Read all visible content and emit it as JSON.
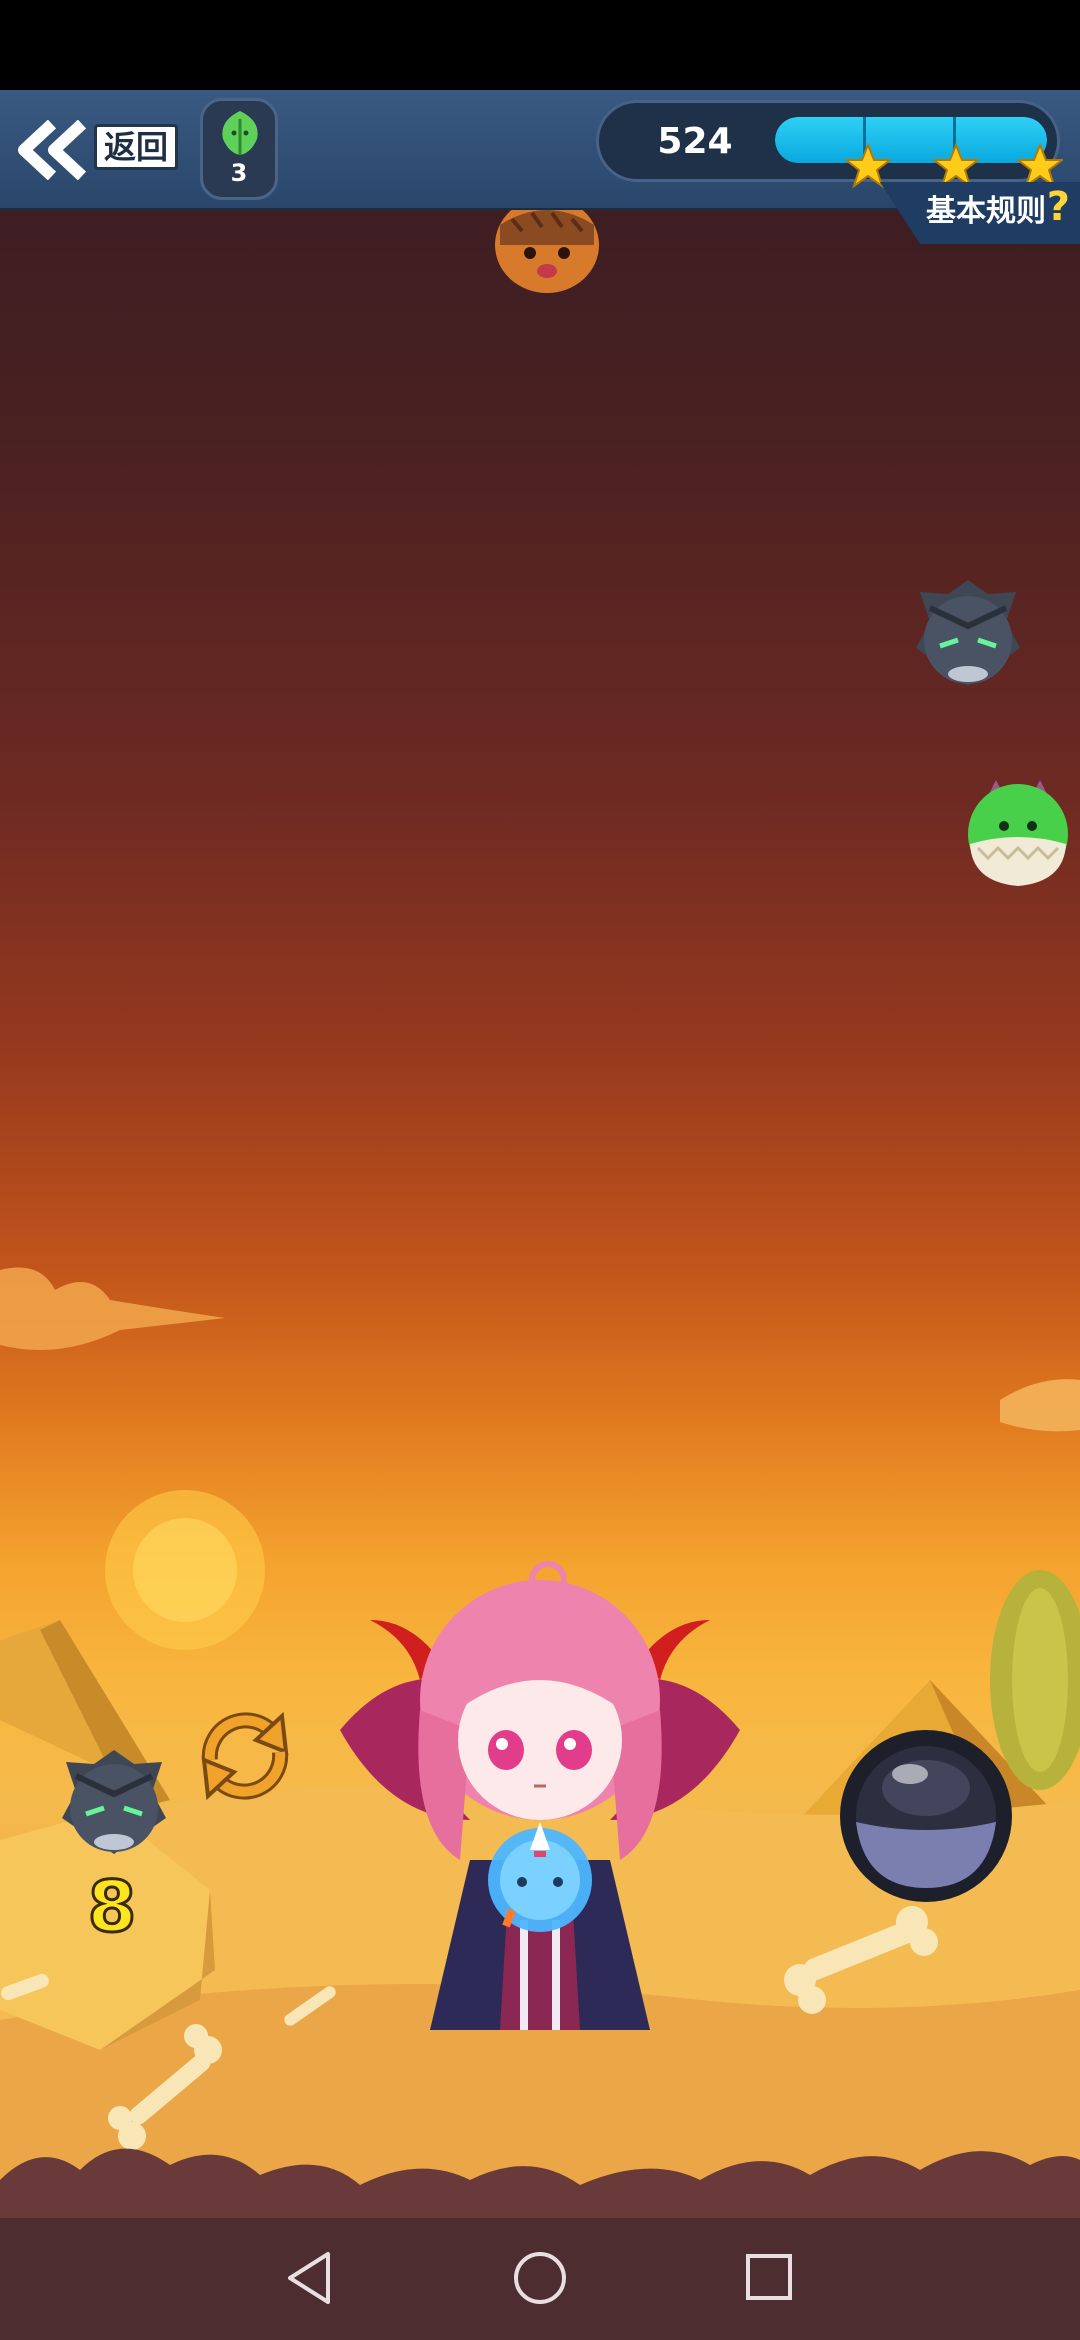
{
  "header": {
    "back_label": "返回",
    "item_count": "3",
    "score": "524",
    "progress_fraction": 1.0,
    "stars_earned": 3,
    "rules_label": "基本规则",
    "rules_question_mark": "?"
  },
  "shooter": {
    "next_bubble_count": "8"
  },
  "colors": {
    "accent_blue": "#12b6e8",
    "star_gold": "#ffcc1a",
    "count_yellow": "#ffe51f"
  },
  "icons": {
    "back": "double-chevron-left-icon",
    "item": "green-leaf-icon",
    "swap": "swap-arrows-icon",
    "nav_back": "triangle-back-icon",
    "nav_home": "circle-home-icon",
    "nav_recents": "square-recents-icon"
  }
}
